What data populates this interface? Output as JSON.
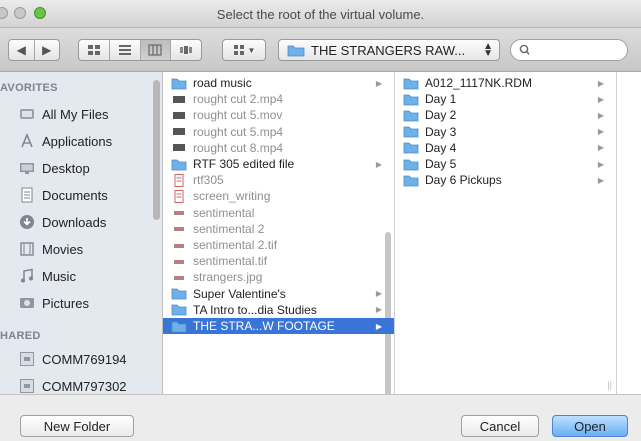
{
  "window": {
    "title": "Select the root of the virtual volume."
  },
  "toolbar": {
    "path_label": "THE STRANGERS RAW...",
    "search_placeholder": "",
    "back_glyph": "◀",
    "forward_glyph": "▶"
  },
  "sidebar": {
    "favorites_label": "AVORITES",
    "favorites": [
      {
        "label": "All My Files",
        "icon": "all-files-icon"
      },
      {
        "label": "Applications",
        "icon": "applications-icon"
      },
      {
        "label": "Desktop",
        "icon": "desktop-icon"
      },
      {
        "label": "Documents",
        "icon": "documents-icon"
      },
      {
        "label": "Downloads",
        "icon": "downloads-icon"
      },
      {
        "label": "Movies",
        "icon": "movies-icon"
      },
      {
        "label": "Music",
        "icon": "music-icon"
      },
      {
        "label": "Pictures",
        "icon": "pictures-icon"
      }
    ],
    "shared_label": "HARED",
    "shared": [
      {
        "label": "COMM769194",
        "icon": "computer-icon"
      },
      {
        "label": "COMM797302",
        "icon": "computer-icon"
      }
    ]
  },
  "column1": {
    "items": [
      {
        "label": "road music",
        "type": "folder",
        "dim": false,
        "selected": false,
        "arrow": true
      },
      {
        "label": "rought cut 2.mp4",
        "type": "video",
        "dim": true,
        "selected": false,
        "arrow": false
      },
      {
        "label": "rought cut 5.mov",
        "type": "video",
        "dim": true,
        "selected": false,
        "arrow": false
      },
      {
        "label": "rought cut 5.mp4",
        "type": "video",
        "dim": true,
        "selected": false,
        "arrow": false
      },
      {
        "label": "rought cut 8.mp4",
        "type": "video",
        "dim": true,
        "selected": false,
        "arrow": false
      },
      {
        "label": "RTF 305 edited file",
        "type": "folder",
        "dim": false,
        "selected": false,
        "arrow": true
      },
      {
        "label": "rtf305",
        "type": "doc",
        "dim": true,
        "selected": false,
        "arrow": false
      },
      {
        "label": "screen_writing",
        "type": "doc",
        "dim": true,
        "selected": false,
        "arrow": false
      },
      {
        "label": "sentimental",
        "type": "file",
        "dim": true,
        "selected": false,
        "arrow": false
      },
      {
        "label": "sentimental 2",
        "type": "file",
        "dim": true,
        "selected": false,
        "arrow": false
      },
      {
        "label": "sentimental 2.tif",
        "type": "file",
        "dim": true,
        "selected": false,
        "arrow": false
      },
      {
        "label": "sentimental.tif",
        "type": "file",
        "dim": true,
        "selected": false,
        "arrow": false
      },
      {
        "label": "strangers.jpg",
        "type": "file",
        "dim": true,
        "selected": false,
        "arrow": false
      },
      {
        "label": "Super Valentine's",
        "type": "folder",
        "dim": false,
        "selected": false,
        "arrow": true
      },
      {
        "label": "TA Intro to...dia Studies",
        "type": "folder",
        "dim": false,
        "selected": false,
        "arrow": true
      },
      {
        "label": "THE STRA...W FOOTAGE",
        "type": "folder",
        "dim": false,
        "selected": true,
        "arrow": true
      }
    ]
  },
  "column2": {
    "items": [
      {
        "label": "A012_1117NK.RDM",
        "type": "folder",
        "arrow": true
      },
      {
        "label": "Day 1",
        "type": "folder",
        "arrow": true
      },
      {
        "label": "Day 2",
        "type": "folder",
        "arrow": true
      },
      {
        "label": "Day 3",
        "type": "folder",
        "arrow": true
      },
      {
        "label": "Day 4",
        "type": "folder",
        "arrow": true
      },
      {
        "label": "Day 5",
        "type": "folder",
        "arrow": true
      },
      {
        "label": "Day 6 Pickups",
        "type": "folder",
        "arrow": true
      }
    ]
  },
  "bottom": {
    "new_folder": "New Folder",
    "cancel": "Cancel",
    "open": "Open"
  },
  "colors": {
    "selection": "#3875d7",
    "folder": "#6fb0e8",
    "accent_button": "#6aaef5"
  }
}
